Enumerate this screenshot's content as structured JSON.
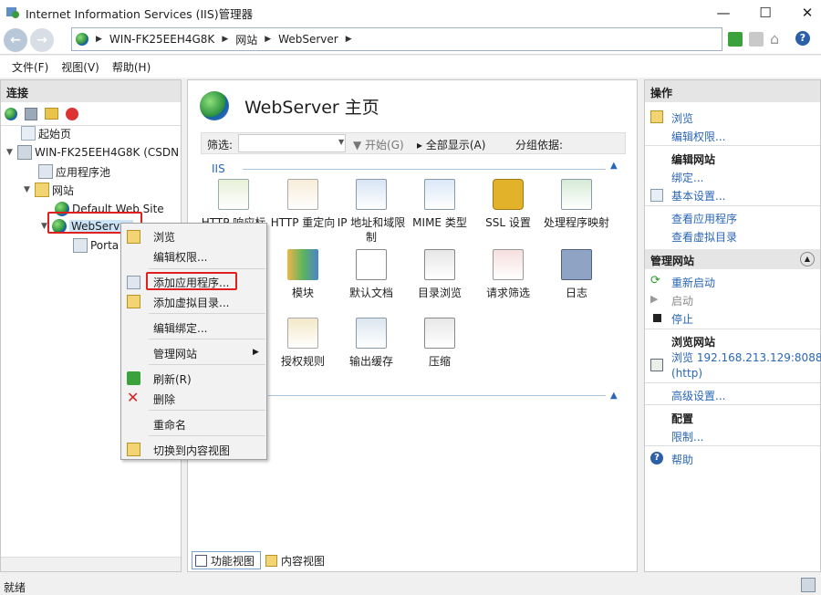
{
  "window": {
    "title": "Internet Information Services (IIS)管理器"
  },
  "address": {
    "crumbs": [
      "WIN-FK25EEH4G8K",
      "网站",
      "WebServer"
    ]
  },
  "menu": [
    "文件(F)",
    "视图(V)",
    "帮助(H)"
  ],
  "left": {
    "header": "连接",
    "tree": {
      "start_page": "起始页",
      "server": "WIN-FK25EEH4G8K (CSDN",
      "app_pools": "应用程序池",
      "sites": "网站",
      "default_site": "Default Web Site",
      "webserver": "WebServer",
      "portal": "Porta"
    }
  },
  "center": {
    "title": "WebServer 主页",
    "filter_label": "筛选:",
    "start_btn": "开始(G)",
    "show_all_btn": "全部显示(A)",
    "group_label": "分组依据:",
    "group_name": "IIS",
    "features": [
      "HTTP 响应标",
      "HTTP 重定向",
      "IP 地址和域限制",
      "MIME 类型",
      "SSL 设置",
      "处理程序映射",
      "",
      "模块",
      "默认文档",
      "目录浏览",
      "请求筛选",
      "日志",
      "",
      "授权规则",
      "输出缓存",
      "压缩"
    ],
    "tabs": {
      "features": "功能视图",
      "content": "内容视图"
    }
  },
  "right": {
    "header": "操作",
    "browse": "浏览",
    "edit_perms": "编辑权限...",
    "edit_site_h": "编辑网站",
    "bindings": "绑定...",
    "basic": "基本设置...",
    "view_apps": "查看应用程序",
    "view_vdirs": "查看虚拟目录",
    "manage_h": "管理网站",
    "restart": "重新启动",
    "start": "启动",
    "stop": "停止",
    "browse_site_h": "浏览网站",
    "browse_addr": "浏览 192.168.213.129:8088",
    "browse_http": "(http)",
    "advanced": "高级设置...",
    "config_h": "配置",
    "limits": "限制...",
    "help": "帮助"
  },
  "context_menu": {
    "browse": "浏览",
    "edit_perms": "编辑权限...",
    "add_app": "添加应用程序...",
    "add_vdir": "添加虚拟目录...",
    "edit_bindings": "编辑绑定...",
    "manage_site": "管理网站",
    "refresh": "刷新(R)",
    "delete": "删除",
    "rename": "重命名",
    "switch_content": "切换到内容视图"
  },
  "status": {
    "text": "就绪"
  },
  "colors": {
    "link": "#2a66b8",
    "highlight": "#e0201e"
  }
}
